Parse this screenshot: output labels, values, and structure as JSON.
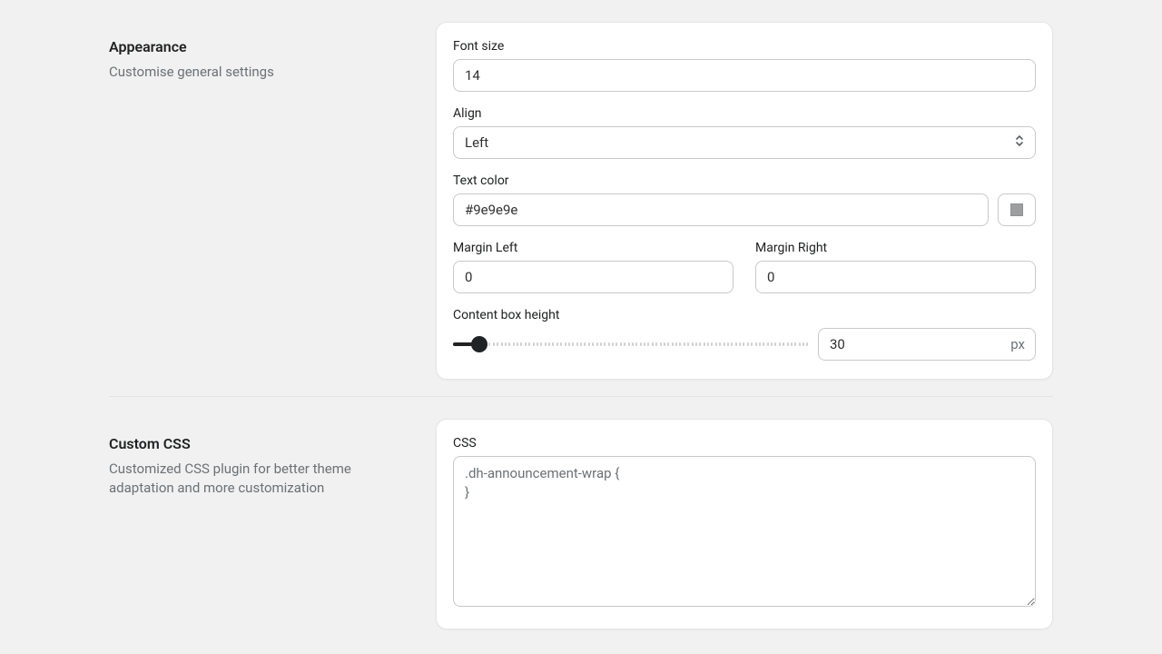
{
  "appearance": {
    "title": "Appearance",
    "desc": "Customise general settings",
    "fields": {
      "font_size": {
        "label": "Font size",
        "value": "14"
      },
      "align": {
        "label": "Align",
        "value": "Left"
      },
      "text_color": {
        "label": "Text color",
        "value": "#9e9e9e",
        "swatch": "#9e9e9e"
      },
      "margin_left": {
        "label": "Margin Left",
        "value": "0"
      },
      "margin_right": {
        "label": "Margin Right",
        "value": "0"
      },
      "content_box_height": {
        "label": "Content box height",
        "value": "30",
        "suffix": "px",
        "min": 0,
        "max": 400
      }
    }
  },
  "custom_css": {
    "title": "Custom CSS",
    "desc": "Customized CSS plugin for better theme adaptation and more customization",
    "fields": {
      "css": {
        "label": "CSS",
        "value": ".dh-announcement-wrap {\n}"
      }
    }
  }
}
